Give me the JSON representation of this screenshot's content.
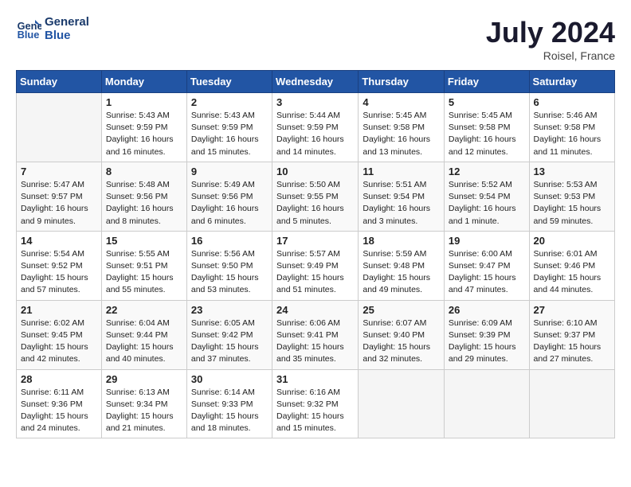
{
  "header": {
    "logo_line1": "General",
    "logo_line2": "Blue",
    "month_year": "July 2024",
    "location": "Roisel, France"
  },
  "weekdays": [
    "Sunday",
    "Monday",
    "Tuesday",
    "Wednesday",
    "Thursday",
    "Friday",
    "Saturday"
  ],
  "weeks": [
    [
      {
        "day": "",
        "sunrise": "",
        "sunset": "",
        "daylight": ""
      },
      {
        "day": "1",
        "sunrise": "Sunrise: 5:43 AM",
        "sunset": "Sunset: 9:59 PM",
        "daylight": "Daylight: 16 hours and 16 minutes."
      },
      {
        "day": "2",
        "sunrise": "Sunrise: 5:43 AM",
        "sunset": "Sunset: 9:59 PM",
        "daylight": "Daylight: 16 hours and 15 minutes."
      },
      {
        "day": "3",
        "sunrise": "Sunrise: 5:44 AM",
        "sunset": "Sunset: 9:59 PM",
        "daylight": "Daylight: 16 hours and 14 minutes."
      },
      {
        "day": "4",
        "sunrise": "Sunrise: 5:45 AM",
        "sunset": "Sunset: 9:58 PM",
        "daylight": "Daylight: 16 hours and 13 minutes."
      },
      {
        "day": "5",
        "sunrise": "Sunrise: 5:45 AM",
        "sunset": "Sunset: 9:58 PM",
        "daylight": "Daylight: 16 hours and 12 minutes."
      },
      {
        "day": "6",
        "sunrise": "Sunrise: 5:46 AM",
        "sunset": "Sunset: 9:58 PM",
        "daylight": "Daylight: 16 hours and 11 minutes."
      }
    ],
    [
      {
        "day": "7",
        "sunrise": "Sunrise: 5:47 AM",
        "sunset": "Sunset: 9:57 PM",
        "daylight": "Daylight: 16 hours and 9 minutes."
      },
      {
        "day": "8",
        "sunrise": "Sunrise: 5:48 AM",
        "sunset": "Sunset: 9:56 PM",
        "daylight": "Daylight: 16 hours and 8 minutes."
      },
      {
        "day": "9",
        "sunrise": "Sunrise: 5:49 AM",
        "sunset": "Sunset: 9:56 PM",
        "daylight": "Daylight: 16 hours and 6 minutes."
      },
      {
        "day": "10",
        "sunrise": "Sunrise: 5:50 AM",
        "sunset": "Sunset: 9:55 PM",
        "daylight": "Daylight: 16 hours and 5 minutes."
      },
      {
        "day": "11",
        "sunrise": "Sunrise: 5:51 AM",
        "sunset": "Sunset: 9:54 PM",
        "daylight": "Daylight: 16 hours and 3 minutes."
      },
      {
        "day": "12",
        "sunrise": "Sunrise: 5:52 AM",
        "sunset": "Sunset: 9:54 PM",
        "daylight": "Daylight: 16 hours and 1 minute."
      },
      {
        "day": "13",
        "sunrise": "Sunrise: 5:53 AM",
        "sunset": "Sunset: 9:53 PM",
        "daylight": "Daylight: 15 hours and 59 minutes."
      }
    ],
    [
      {
        "day": "14",
        "sunrise": "Sunrise: 5:54 AM",
        "sunset": "Sunset: 9:52 PM",
        "daylight": "Daylight: 15 hours and 57 minutes."
      },
      {
        "day": "15",
        "sunrise": "Sunrise: 5:55 AM",
        "sunset": "Sunset: 9:51 PM",
        "daylight": "Daylight: 15 hours and 55 minutes."
      },
      {
        "day": "16",
        "sunrise": "Sunrise: 5:56 AM",
        "sunset": "Sunset: 9:50 PM",
        "daylight": "Daylight: 15 hours and 53 minutes."
      },
      {
        "day": "17",
        "sunrise": "Sunrise: 5:57 AM",
        "sunset": "Sunset: 9:49 PM",
        "daylight": "Daylight: 15 hours and 51 minutes."
      },
      {
        "day": "18",
        "sunrise": "Sunrise: 5:59 AM",
        "sunset": "Sunset: 9:48 PM",
        "daylight": "Daylight: 15 hours and 49 minutes."
      },
      {
        "day": "19",
        "sunrise": "Sunrise: 6:00 AM",
        "sunset": "Sunset: 9:47 PM",
        "daylight": "Daylight: 15 hours and 47 minutes."
      },
      {
        "day": "20",
        "sunrise": "Sunrise: 6:01 AM",
        "sunset": "Sunset: 9:46 PM",
        "daylight": "Daylight: 15 hours and 44 minutes."
      }
    ],
    [
      {
        "day": "21",
        "sunrise": "Sunrise: 6:02 AM",
        "sunset": "Sunset: 9:45 PM",
        "daylight": "Daylight: 15 hours and 42 minutes."
      },
      {
        "day": "22",
        "sunrise": "Sunrise: 6:04 AM",
        "sunset": "Sunset: 9:44 PM",
        "daylight": "Daylight: 15 hours and 40 minutes."
      },
      {
        "day": "23",
        "sunrise": "Sunrise: 6:05 AM",
        "sunset": "Sunset: 9:42 PM",
        "daylight": "Daylight: 15 hours and 37 minutes."
      },
      {
        "day": "24",
        "sunrise": "Sunrise: 6:06 AM",
        "sunset": "Sunset: 9:41 PM",
        "daylight": "Daylight: 15 hours and 35 minutes."
      },
      {
        "day": "25",
        "sunrise": "Sunrise: 6:07 AM",
        "sunset": "Sunset: 9:40 PM",
        "daylight": "Daylight: 15 hours and 32 minutes."
      },
      {
        "day": "26",
        "sunrise": "Sunrise: 6:09 AM",
        "sunset": "Sunset: 9:39 PM",
        "daylight": "Daylight: 15 hours and 29 minutes."
      },
      {
        "day": "27",
        "sunrise": "Sunrise: 6:10 AM",
        "sunset": "Sunset: 9:37 PM",
        "daylight": "Daylight: 15 hours and 27 minutes."
      }
    ],
    [
      {
        "day": "28",
        "sunrise": "Sunrise: 6:11 AM",
        "sunset": "Sunset: 9:36 PM",
        "daylight": "Daylight: 15 hours and 24 minutes."
      },
      {
        "day": "29",
        "sunrise": "Sunrise: 6:13 AM",
        "sunset": "Sunset: 9:34 PM",
        "daylight": "Daylight: 15 hours and 21 minutes."
      },
      {
        "day": "30",
        "sunrise": "Sunrise: 6:14 AM",
        "sunset": "Sunset: 9:33 PM",
        "daylight": "Daylight: 15 hours and 18 minutes."
      },
      {
        "day": "31",
        "sunrise": "Sunrise: 6:16 AM",
        "sunset": "Sunset: 9:32 PM",
        "daylight": "Daylight: 15 hours and 15 minutes."
      },
      {
        "day": "",
        "sunrise": "",
        "sunset": "",
        "daylight": ""
      },
      {
        "day": "",
        "sunrise": "",
        "sunset": "",
        "daylight": ""
      },
      {
        "day": "",
        "sunrise": "",
        "sunset": "",
        "daylight": ""
      }
    ]
  ]
}
